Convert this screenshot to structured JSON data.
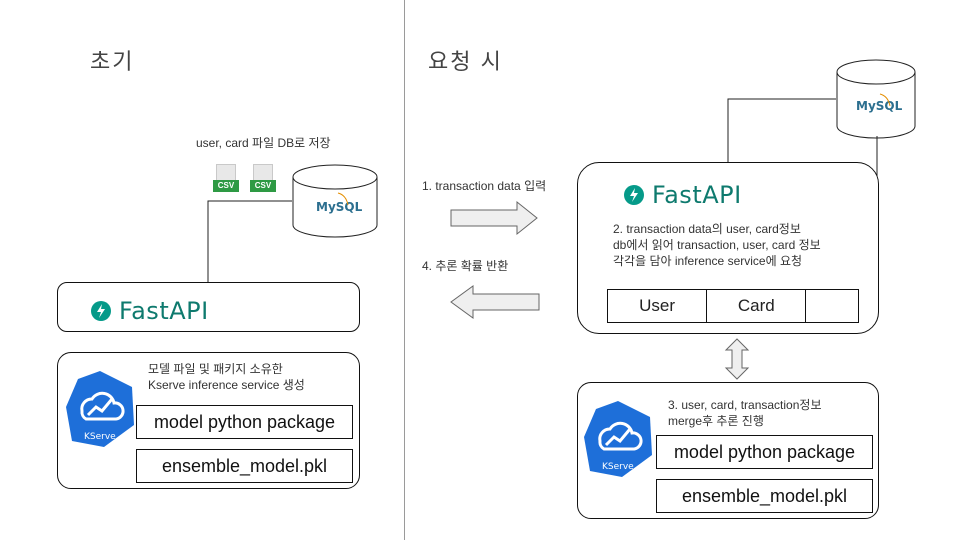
{
  "left": {
    "title": "초기",
    "upload_note": "user, card 파일 DB로 저장",
    "csv_label": "CSV",
    "mysql_label": "MySQL",
    "fastapi_label": "FastAPI",
    "kserve": {
      "description_line1": "모델 파일 및 패키지 소유한",
      "description_line2": "Kserve inference service 생성",
      "logo_label": "KServe",
      "package_label": "model python package",
      "pkl_label": "ensemble_model.pkl"
    }
  },
  "right": {
    "title": "요청 시",
    "step1": "1. transaction data 입력",
    "step4": "4. 추론 확률 반환",
    "mysql_label": "MySQL",
    "fastapi_label": "FastAPI",
    "step2_line1": "2. transaction data의 user, card정보",
    "step2_line2": "db에서 읽어 transaction, user, card 정보",
    "step2_line3": "각각을 담아 inference service에 요청",
    "table_cells": [
      "User",
      "Card",
      ""
    ],
    "kserve": {
      "step3_line1": "3. user, card, transaction정보",
      "step3_line2": "merge후 추론 진행",
      "logo_label": "KServe",
      "package_label": "model python package",
      "pkl_label": "ensemble_model.pkl"
    }
  },
  "colors": {
    "fastapi": "#059a89",
    "kserve": "#1e6fd9",
    "csv": "#2e9a44"
  }
}
